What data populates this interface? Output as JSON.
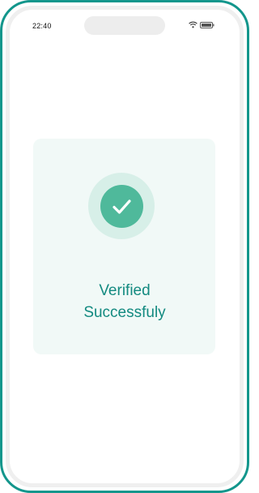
{
  "status_bar": {
    "time": "22:40",
    "wifi_icon": "wifi-icon",
    "battery_icon": "battery-icon"
  },
  "verification": {
    "icon": "check-icon",
    "message": "Verified\nSuccessfuly"
  },
  "colors": {
    "frame": "#13968c",
    "card_background": "#f1f9f7",
    "halo": "#d7efe8",
    "check_circle": "#4fb99b",
    "message_text": "#138a80"
  }
}
